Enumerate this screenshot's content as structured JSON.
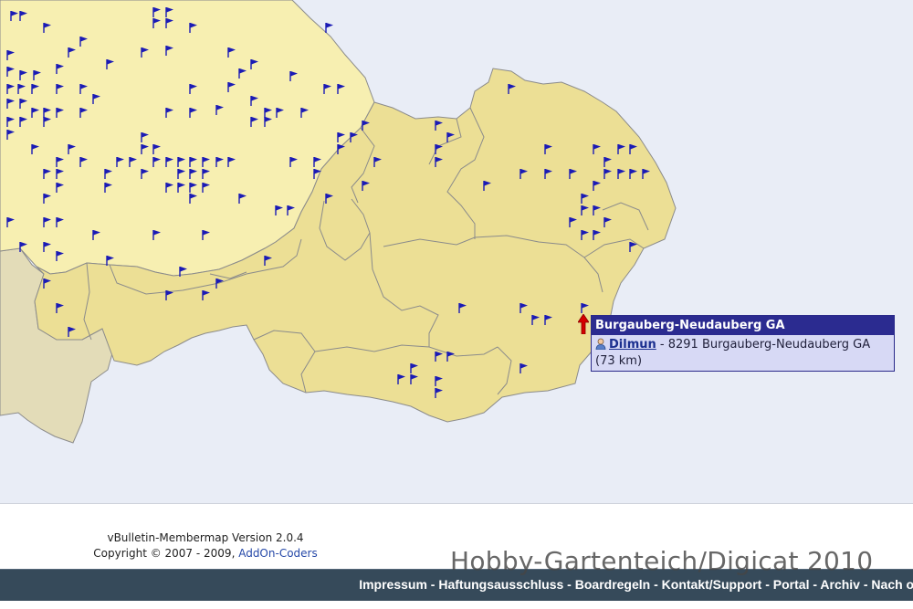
{
  "map": {
    "colors": {
      "water": "#e9edf6",
      "germany": "#f7efb1",
      "austria": "#ecdf95",
      "switzerland": "#e3dcb8",
      "border": "#8b8b8b",
      "flag": "#1b1bb5"
    },
    "icons": {
      "flag": "flag-icon",
      "marker": "red-arrow-marker-icon",
      "user": "user-icon"
    }
  },
  "tooltip": {
    "title": "Burgauberg-Neudauberg GA",
    "user": "Dilmun",
    "location": " - 8291 Burgauberg-Neudauberg GA (73 km)"
  },
  "footer": {
    "version": "vBulletin-Membermap Version 2.0.4",
    "copyright": "Copyright © 2007 - 2009, ",
    "copyright_link": "AddOn-Coders",
    "links": [
      "Impressum",
      "Haftungsausschluss",
      "Boardregeln",
      "Kontakt/Support",
      "Portal",
      "Archiv",
      "Nach oben"
    ],
    "separator": " - "
  },
  "watermark": "Hobby-Gartenteich/Digicat 2010"
}
